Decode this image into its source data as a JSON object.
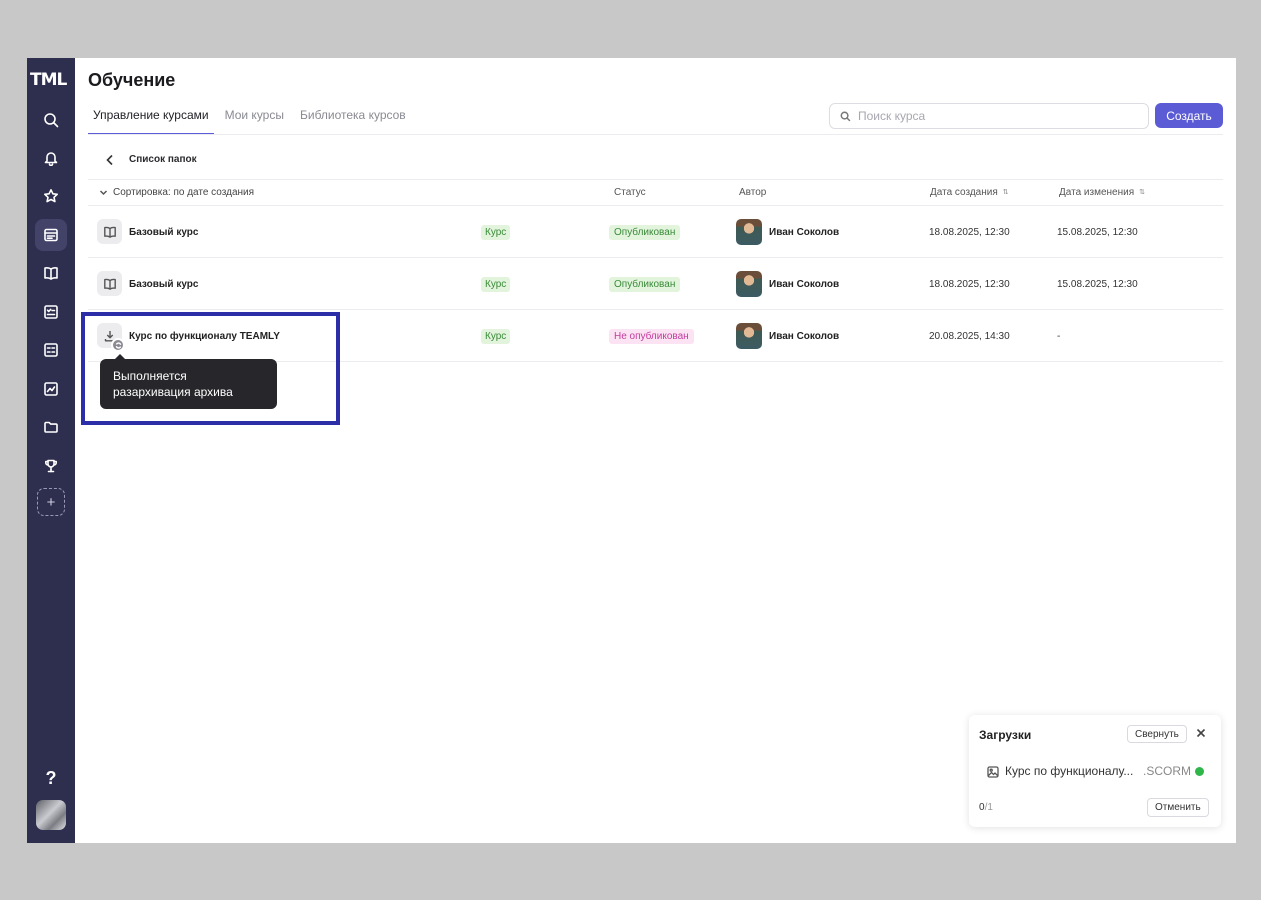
{
  "app": {
    "logo": "TML"
  },
  "sidebar": {
    "items": [
      {
        "name": "search",
        "icon": "search-icon"
      },
      {
        "name": "notifications",
        "icon": "bell-icon"
      },
      {
        "name": "favorites",
        "icon": "star-icon"
      },
      {
        "name": "learning",
        "icon": "courses-icon",
        "active": true
      },
      {
        "name": "library",
        "icon": "book-icon"
      },
      {
        "name": "tests",
        "icon": "checklist-icon"
      },
      {
        "name": "calculator",
        "icon": "grid-icon"
      },
      {
        "name": "analytics",
        "icon": "chart-icon"
      },
      {
        "name": "files",
        "icon": "folder-icon"
      },
      {
        "name": "achievements",
        "icon": "trophy-icon"
      }
    ],
    "add_label": "+",
    "help_label": "?"
  },
  "header": {
    "title": "Обучение",
    "tabs": [
      {
        "label": "Управление курсами",
        "active": true
      },
      {
        "label": "Мои курсы",
        "active": false
      },
      {
        "label": "Библиотека курсов",
        "active": false
      }
    ],
    "search_placeholder": "Поиск курса",
    "create_label": "Создать"
  },
  "breadcrumb": {
    "label": "Список папок"
  },
  "table": {
    "sort_label": "Сортировка: по дате создания",
    "columns": {
      "status": "Статус",
      "author": "Автор",
      "created": "Дата создания",
      "modified": "Дата изменения"
    },
    "rows": [
      {
        "name": "Базовый курс",
        "type": "Курс",
        "status": "Опубликован",
        "author": "Иван Соколов",
        "created": "18.08.2025, 12:30",
        "modified": "15.08.2025, 12:30"
      },
      {
        "name": "Базовый курс",
        "type": "Курс",
        "status": "Опубликован",
        "author": "Иван Соколов",
        "created": "18.08.2025, 12:30",
        "modified": "15.08.2025, 12:30"
      },
      {
        "name": "Курс по функционалу TEAMLY",
        "type": "Курс",
        "status": "Не опубликован",
        "author": "Иван Соколов",
        "created": "20.08.2025, 14:30",
        "modified": "-"
      }
    ]
  },
  "tooltip": {
    "text": "Выполняется разархивация архива"
  },
  "downloads": {
    "title": "Загрузки",
    "collapse_label": "Свернуть",
    "file_name": "Курс по функционалу...",
    "file_ext": ".SCORM",
    "count_done": "0",
    "count_total": "/1",
    "cancel_label": "Отменить"
  },
  "colors": {
    "accent": "#5b5bd6",
    "sidebar": "#2e2e4e",
    "highlight": "#2c2ea8",
    "published": "#3a8a3a",
    "unpublished": "#c23c9c"
  }
}
